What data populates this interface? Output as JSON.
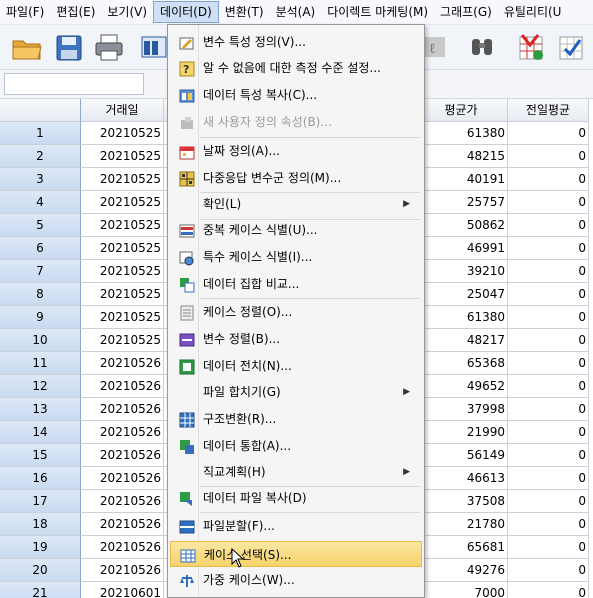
{
  "menubar": {
    "items": [
      {
        "label": "파일(F)"
      },
      {
        "label": "편집(E)"
      },
      {
        "label": "보기(V)"
      },
      {
        "label": "데이터(D)",
        "active": true
      },
      {
        "label": "변환(T)"
      },
      {
        "label": "분석(A)"
      },
      {
        "label": "다이렉트 마케팅(M)"
      },
      {
        "label": "그래프(G)"
      },
      {
        "label": "유틸리티(U"
      }
    ]
  },
  "toolbar": {
    "icons": [
      "open-folder-icon",
      "save-icon",
      "print-icon",
      "dialog-recall-icon",
      "help-icon",
      "binoculars-icon",
      "insert-cases-icon",
      "select-cases-icon"
    ]
  },
  "grid": {
    "headers": [
      "거래일",
      "평균가",
      "전일평균"
    ],
    "rows": [
      {
        "n": "1",
        "date": "20210525",
        "avg": "61380",
        "prev": "0"
      },
      {
        "n": "2",
        "date": "20210525",
        "avg": "48215",
        "prev": "0"
      },
      {
        "n": "3",
        "date": "20210525",
        "avg": "40191",
        "prev": "0"
      },
      {
        "n": "4",
        "date": "20210525",
        "avg": "25757",
        "prev": "0"
      },
      {
        "n": "5",
        "date": "20210525",
        "avg": "50862",
        "prev": "0"
      },
      {
        "n": "6",
        "date": "20210525",
        "avg": "46991",
        "prev": "0"
      },
      {
        "n": "7",
        "date": "20210525",
        "avg": "39210",
        "prev": "0"
      },
      {
        "n": "8",
        "date": "20210525",
        "avg": "25047",
        "prev": "0"
      },
      {
        "n": "9",
        "date": "20210525",
        "avg": "61380",
        "prev": "0"
      },
      {
        "n": "10",
        "date": "20210525",
        "avg": "48217",
        "prev": "0"
      },
      {
        "n": "11",
        "date": "20210526",
        "avg": "65368",
        "prev": "0"
      },
      {
        "n": "12",
        "date": "20210526",
        "avg": "49652",
        "prev": "0"
      },
      {
        "n": "13",
        "date": "20210526",
        "avg": "37998",
        "prev": "0"
      },
      {
        "n": "14",
        "date": "20210526",
        "avg": "21990",
        "prev": "0"
      },
      {
        "n": "15",
        "date": "20210526",
        "avg": "56149",
        "prev": "0"
      },
      {
        "n": "16",
        "date": "20210526",
        "avg": "46613",
        "prev": "0"
      },
      {
        "n": "17",
        "date": "20210526",
        "avg": "37508",
        "prev": "0"
      },
      {
        "n": "18",
        "date": "20210526",
        "avg": "21780",
        "prev": "0"
      },
      {
        "n": "19",
        "date": "20210526",
        "avg": "65681",
        "prev": "0"
      },
      {
        "n": "20",
        "date": "20210526",
        "avg": "49276",
        "prev": "0"
      },
      {
        "n": "21",
        "date": "20210601",
        "avg": "7000",
        "prev": "0"
      }
    ]
  },
  "data_menu": {
    "items": [
      {
        "label": "변수 특성 정의(V)...",
        "icon": "define-variable-icon"
      },
      {
        "label": "알 수 없음에 대한 측정 수준 설정...",
        "icon": "measurement-level-icon"
      },
      {
        "label": "데이터 특성 복사(C)...",
        "icon": "copy-properties-icon"
      },
      {
        "label": "새 사용자 정의 속성(B)...",
        "icon": "custom-attribute-icon",
        "disabled": true
      },
      {
        "label": "날짜 정의(A)...",
        "icon": "calendar-icon"
      },
      {
        "label": "다중응답 변수군 정의(M)...",
        "icon": "multiple-response-icon"
      },
      {
        "label": "확인(L)",
        "submenu": true
      },
      {
        "label": "중복 케이스 식별(U)...",
        "icon": "duplicate-cases-icon"
      },
      {
        "label": "특수 케이스 식별(I)...",
        "icon": "unusual-cases-icon"
      },
      {
        "label": "데이터 집합 비교...",
        "icon": "compare-datasets-icon"
      },
      {
        "label": "케이스 정렬(O)...",
        "icon": "sort-cases-icon"
      },
      {
        "label": "변수 정렬(B)...",
        "icon": "sort-variables-icon"
      },
      {
        "label": "데이터 전치(N)...",
        "icon": "transpose-icon"
      },
      {
        "label": "파일 합치기(G)",
        "submenu": true
      },
      {
        "label": "구조변환(R)...",
        "icon": "restructure-icon"
      },
      {
        "label": "데이터 통합(A)...",
        "icon": "aggregate-icon"
      },
      {
        "label": "직교계획(H)",
        "submenu": true
      },
      {
        "label": "데이터 파일 복사(D)",
        "icon": "copy-dataset-icon"
      },
      {
        "label": "파일분할(F)...",
        "icon": "split-file-icon"
      },
      {
        "label": "케이스 선택(S)...",
        "icon": "select-cases-icon",
        "highlighted": true
      },
      {
        "label": "가중 케이스(W)...",
        "icon": "weight-cases-icon"
      }
    ]
  }
}
